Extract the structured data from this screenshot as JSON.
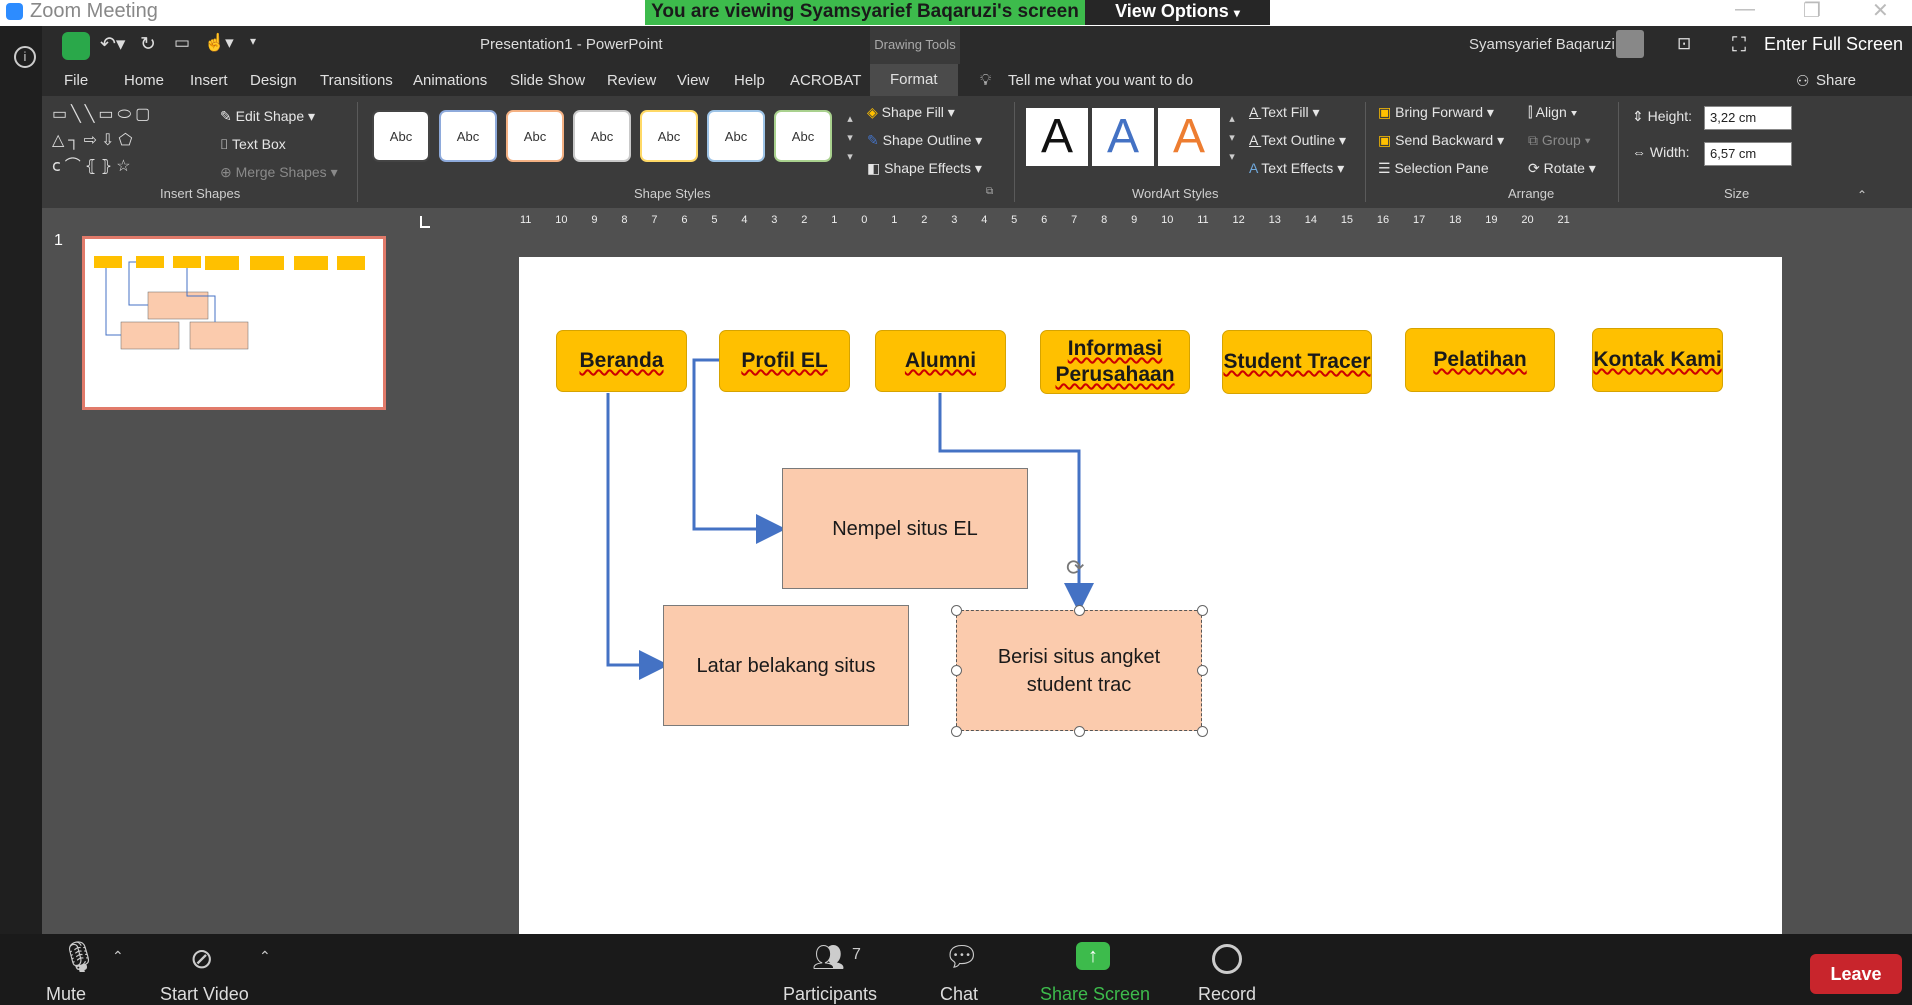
{
  "zoom": {
    "window_title": "Zoom Meeting",
    "share_banner": "You are viewing Syamsyarief Baqaruzi's screen",
    "view_options": "View Options",
    "enter_full_screen": "Enter Full Screen",
    "bottom": {
      "mute": "Mute",
      "start_video": "Start Video",
      "participants": "Participants",
      "participants_count": "7",
      "chat": "Chat",
      "share_screen": "Share Screen",
      "record": "Record",
      "leave": "Leave"
    }
  },
  "ppt": {
    "doc_title": "Presentation1  -  PowerPoint",
    "context_tab_group": "Drawing Tools",
    "user": "Syamsyarief Baqaruzi",
    "tabs": [
      "File",
      "Home",
      "Insert",
      "Design",
      "Transitions",
      "Animations",
      "Slide Show",
      "Review",
      "View",
      "Help",
      "ACROBAT",
      "Format"
    ],
    "tell_me": "Tell me what you want to do",
    "share": "Share",
    "ribbon": {
      "insert_shapes": {
        "label": "Insert Shapes",
        "edit_shape": "Edit Shape",
        "text_box": "Text Box",
        "merge_shapes": "Merge Shapes"
      },
      "shape_styles": {
        "label": "Shape Styles",
        "swatch_text": "Abc",
        "swatch_colors": [
          "#000000",
          "#4472c4",
          "#ed7d31",
          "#a5a5a5",
          "#ffc000",
          "#5b9bd5",
          "#70ad47"
        ],
        "shape_fill": "Shape Fill",
        "shape_outline": "Shape Outline",
        "shape_effects": "Shape Effects"
      },
      "wordart": {
        "label": "WordArt Styles",
        "letter": "A",
        "text_fill": "Text Fill",
        "text_outline": "Text Outline",
        "text_effects": "Text Effects"
      },
      "arrange": {
        "label": "Arrange",
        "bring_forward": "Bring Forward",
        "send_backward": "Send Backward",
        "selection_pane": "Selection Pane",
        "align": "Align",
        "group": "Group",
        "rotate": "Rotate"
      },
      "size": {
        "label": "Size",
        "height_label": "Height:",
        "height_value": "3,22 cm",
        "width_label": "Width:",
        "width_value": "6,57 cm"
      }
    },
    "slide_number": "1",
    "slide": {
      "nav": [
        "Beranda",
        "Profil EL",
        "Alumni",
        "Informasi Perusahaan",
        "Student Tracer",
        "Pelatihan",
        "Kontak Kami"
      ],
      "box_nempel": "Nempel situs EL",
      "box_latar": "Latar belakang situs",
      "box_berisi_line1": "Berisi situs angket",
      "box_berisi_line2": "student trac"
    },
    "ruler_h_ticks": [
      "11",
      "10",
      "9",
      "8",
      "7",
      "6",
      "5",
      "4",
      "3",
      "2",
      "1",
      "0",
      "1",
      "2",
      "3",
      "4",
      "5",
      "6",
      "7",
      "8",
      "9",
      "10",
      "11",
      "12",
      "13",
      "14",
      "15",
      "16",
      "17",
      "18",
      "19",
      "20",
      "21"
    ],
    "colors": {
      "accent_line": "#4472c4",
      "nav_fill": "#ffc000",
      "box_fill": "#fbcbad"
    }
  }
}
